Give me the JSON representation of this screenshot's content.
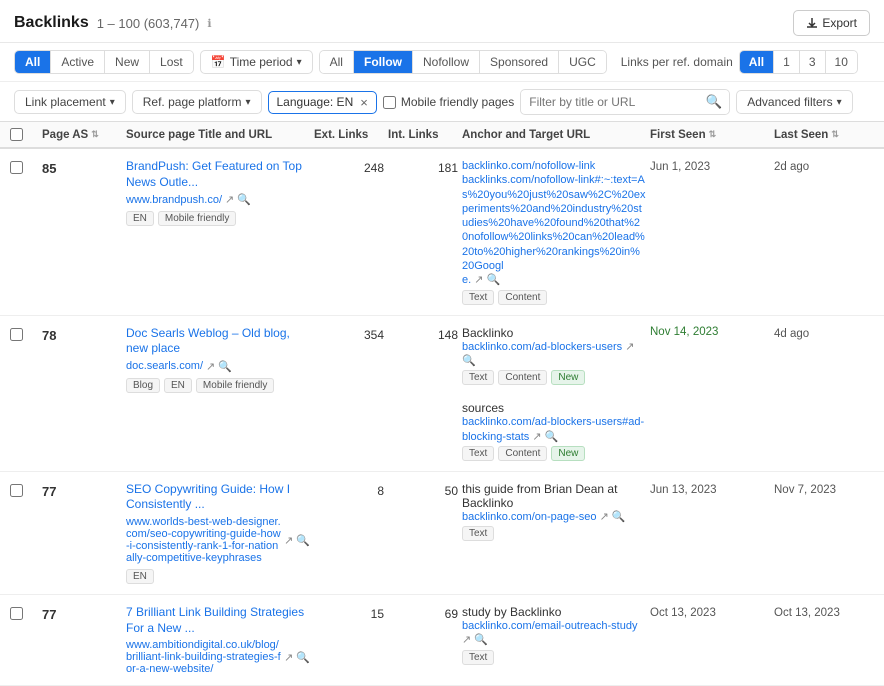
{
  "header": {
    "title": "Backlinks",
    "count": "1 – 100 (603,747)",
    "info_icon": "ℹ",
    "export_label": "Export"
  },
  "filter_bar_1": {
    "tabs_all_label": "All",
    "tabs_active_label": "Active",
    "tabs_new_label": "New",
    "tabs_lost_label": "Lost",
    "time_period_label": "Time period",
    "type_label_all": "All",
    "type_label_follow": "Follow",
    "type_label_nofollow": "Nofollow",
    "type_label_sponsored": "Sponsored",
    "type_label_ugc": "UGC",
    "links_per_ref_label": "Links per ref. domain",
    "num_all": "All",
    "num_1": "1",
    "num_3": "3",
    "num_10": "10"
  },
  "filter_bar_2": {
    "link_placement_label": "Link placement",
    "ref_page_platform_label": "Ref. page platform",
    "language_label": "Language: EN",
    "mobile_label": "Mobile friendly pages",
    "url_placeholder": "Filter by title or URL",
    "adv_filters_label": "Advanced filters"
  },
  "table": {
    "columns": [
      "",
      "Page AS",
      "Source page Title and URL",
      "Ext. Links",
      "Int. Links",
      "Anchor and Target URL",
      "First Seen",
      "Last Seen"
    ],
    "rows": [
      {
        "page_as": "85",
        "source_title": "BrandPush: Get Featured on Top News Outle...",
        "source_url": "www.brandpush.co/",
        "tags": [
          "EN",
          "Mobile friendly"
        ],
        "ext_links": "248",
        "int_links": "181",
        "anchors": [
          {
            "name": "backlinks.com/nofollow-link",
            "url": "backlinks.com/nofollow-link#:~:text=As%20you%20just%20saw%2C%20experiments%20and%20industry%20studies%20have%20found%20that%20nofollow%20links%20can%20lead%20to%20higher%20rankings%20in%20Google.",
            "tags": [
              "Text",
              "Content"
            ]
          }
        ],
        "first_seen": "Jun 1, 2023",
        "last_seen": "2d ago",
        "first_seen_color": "normal",
        "last_seen_color": "normal"
      },
      {
        "page_as": "78",
        "source_title": "Doc Searls Weblog – Old blog, new place",
        "source_url": "doc.searls.com/",
        "tags": [
          "Blog",
          "EN",
          "Mobile friendly"
        ],
        "ext_links": "354",
        "int_links": "148",
        "anchors": [
          {
            "name": "Backlinko",
            "url": "backlinko.com/ad-blockers-users",
            "tags": [
              "Text",
              "Content",
              "New"
            ],
            "first_seen": "Nov 14, 2023",
            "last_seen": "4d ago"
          },
          {
            "name": "sources",
            "url": "backlinko.com/ad-blockers-users#ad-blocking-stats",
            "tags": [
              "Text",
              "Content",
              "New"
            ],
            "first_seen": "Nov 14, 2023",
            "last_seen": "4d ago"
          }
        ],
        "first_seen": "Nov 14, 2023",
        "last_seen": "4d ago",
        "first_seen_color": "green",
        "last_seen_color": "normal"
      },
      {
        "page_as": "77",
        "source_title": "SEO Copywriting Guide: How I Consistently ...",
        "source_url": "www.worlds-best-web-designer.com/seo-copywriting-guide-how-i-consistently-rank-1-for-nationally-competitive-keyphrases",
        "tags": [
          "EN"
        ],
        "ext_links": "8",
        "int_links": "50",
        "anchors": [
          {
            "name": "this guide from Brian Dean at Backlinko",
            "url": "backlinko.com/on-page-seo",
            "tags": [
              "Text"
            ]
          }
        ],
        "first_seen": "Jun 13, 2023",
        "last_seen": "Nov 7, 2023",
        "first_seen_color": "normal",
        "last_seen_color": "normal"
      },
      {
        "page_as": "77",
        "source_title": "7 Brilliant Link Building Strategies For a New ...",
        "source_url": "www.ambitiondigital.co.uk/blog/brilliant-link-building-strategies-for-a-new-website/",
        "tags": [],
        "ext_links": "15",
        "int_links": "69",
        "anchors": [
          {
            "name": "study by Backlinko",
            "url": "backlinko.com/email-outreach-study",
            "tags": [
              "Text"
            ]
          }
        ],
        "first_seen": "Oct 13, 2023",
        "last_seen": "Oct 13, 2023",
        "first_seen_color": "normal",
        "last_seen_color": "normal"
      }
    ]
  }
}
